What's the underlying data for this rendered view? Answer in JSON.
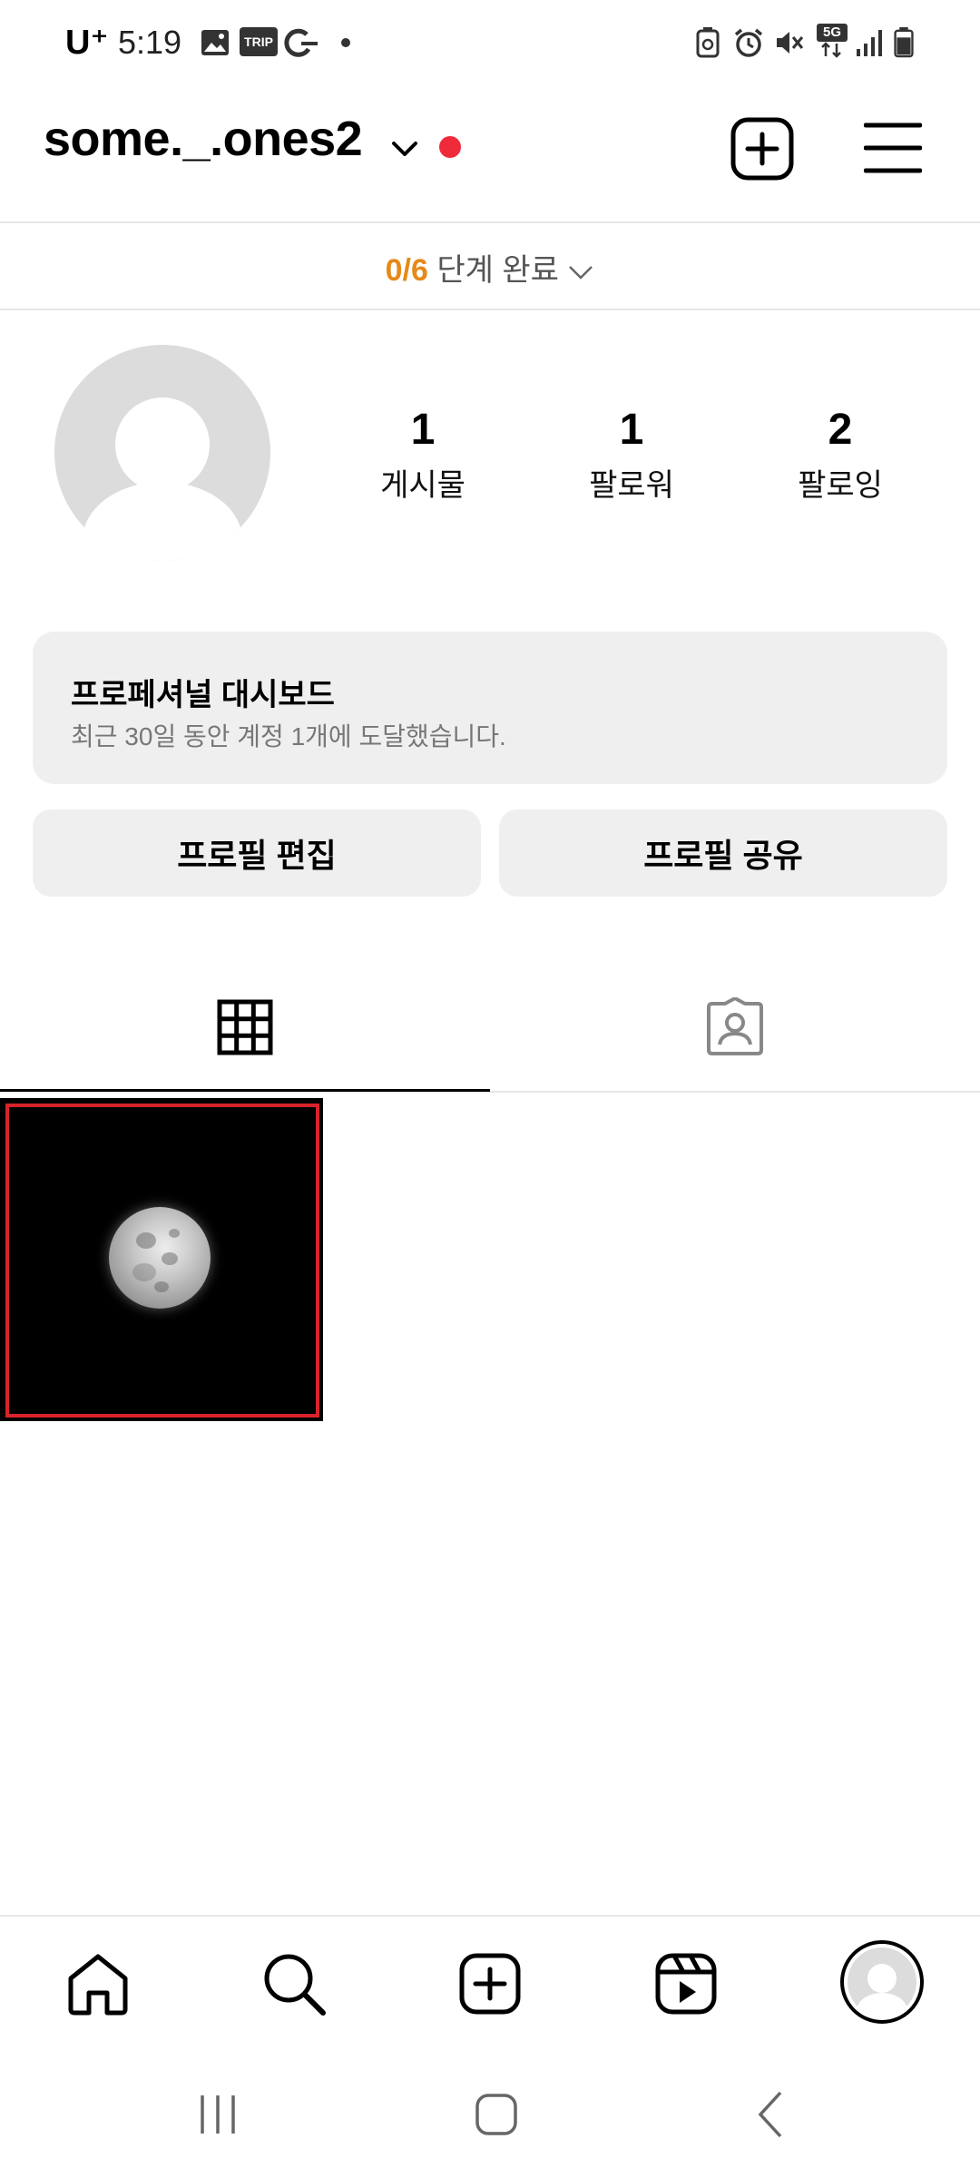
{
  "status_bar": {
    "carrier": "U⁺",
    "time": "5:19",
    "icons": [
      "gallery-icon",
      "trip-badge-icon",
      "g-icon",
      "dot-icon",
      "cleaner-icon",
      "alarm-icon",
      "mute-icon",
      "5g-icon",
      "signal-icon",
      "battery-icon"
    ],
    "trip_label": "TRIP",
    "network_label": "5G"
  },
  "header": {
    "username": "some._.ones2",
    "icons": [
      "chevron-down-icon",
      "notification-dot",
      "create-post-icon",
      "menu-icon"
    ]
  },
  "steps": {
    "count": "0/6",
    "label": "단계 완료"
  },
  "profile": {
    "stats": [
      {
        "value": "1",
        "label": "게시물"
      },
      {
        "value": "1",
        "label": "팔로워"
      },
      {
        "value": "2",
        "label": "팔로잉"
      }
    ]
  },
  "dashboard": {
    "title": "프로페셔널 대시보드",
    "subtitle": "최근 30일 동안 계정 1개에 도달했습니다."
  },
  "buttons": {
    "edit_profile": "프로필 편집",
    "share_profile": "프로필 공유"
  },
  "tabs": [
    {
      "name": "posts-grid",
      "icon": "grid-icon",
      "active": true
    },
    {
      "name": "tagged",
      "icon": "tagged-person-icon",
      "active": false
    }
  ],
  "posts": [
    {
      "image": "full moon on black sky",
      "selected": true
    }
  ],
  "bottom_nav": [
    "home-icon",
    "search-icon",
    "create-icon",
    "reels-icon",
    "profile-avatar"
  ],
  "system_nav": [
    "recent-apps-icon",
    "home-button-icon",
    "back-icon"
  ],
  "colors": {
    "accent_orange": "#e58a18",
    "notification_red": "#ee2a3b",
    "selection_red": "#d8232a"
  }
}
